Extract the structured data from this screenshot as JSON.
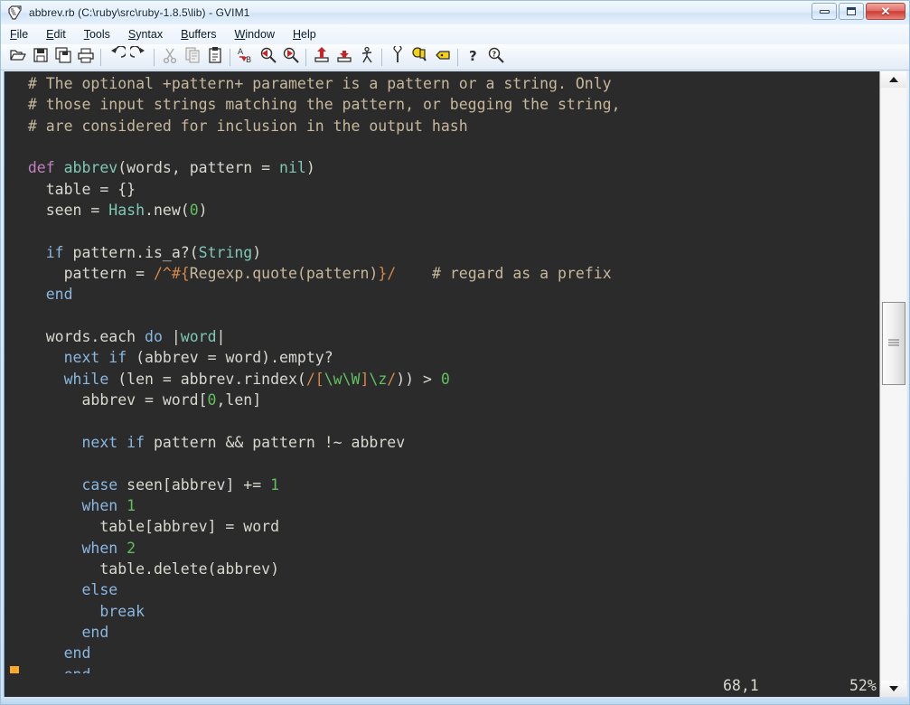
{
  "window": {
    "title": "abbrev.rb (C:\\ruby\\src\\ruby-1.8.5\\lib) - GVIM1",
    "app_icon": "vim-icon",
    "controls": {
      "minimize": "minimize-button",
      "maximize": "maximize-button",
      "close": "close-button",
      "close_glyph": "✕"
    }
  },
  "menubar": {
    "items": [
      {
        "label": "File",
        "accel": "F"
      },
      {
        "label": "Edit",
        "accel": "E"
      },
      {
        "label": "Tools",
        "accel": "T"
      },
      {
        "label": "Syntax",
        "accel": "S"
      },
      {
        "label": "Buffers",
        "accel": "B"
      },
      {
        "label": "Window",
        "accel": "W"
      },
      {
        "label": "Help",
        "accel": "H"
      }
    ]
  },
  "toolbar": {
    "buttons": [
      {
        "name": "open-file-icon",
        "enabled": true
      },
      {
        "name": "save-file-icon",
        "enabled": true
      },
      {
        "name": "save-all-icon",
        "enabled": true
      },
      {
        "name": "print-icon",
        "enabled": true
      },
      {
        "name": "separator"
      },
      {
        "name": "undo-icon",
        "enabled": true
      },
      {
        "name": "redo-icon",
        "enabled": true
      },
      {
        "name": "separator"
      },
      {
        "name": "cut-icon",
        "enabled": false
      },
      {
        "name": "copy-icon",
        "enabled": false
      },
      {
        "name": "paste-icon",
        "enabled": true
      },
      {
        "name": "separator"
      },
      {
        "name": "find-replace-icon",
        "enabled": true
      },
      {
        "name": "find-next-icon",
        "enabled": true
      },
      {
        "name": "find-previous-icon",
        "enabled": true
      },
      {
        "name": "separator"
      },
      {
        "name": "load-session-icon",
        "enabled": true
      },
      {
        "name": "save-session-icon",
        "enabled": true
      },
      {
        "name": "run-script-icon",
        "enabled": true
      },
      {
        "name": "separator"
      },
      {
        "name": "make-icon",
        "enabled": true
      },
      {
        "name": "build-tags-icon",
        "enabled": true
      },
      {
        "name": "jump-to-tag-icon",
        "enabled": true
      },
      {
        "name": "separator"
      },
      {
        "name": "help-icon",
        "enabled": true
      },
      {
        "name": "find-help-icon",
        "enabled": true
      }
    ]
  },
  "editor": {
    "filetype": "ruby",
    "background": "#2b2b2b",
    "cursor_color": "#ffa726",
    "lines": [
      [
        {
          "t": "  ",
          "c": "ident"
        },
        {
          "t": "# The optional +pattern+ parameter is a pattern or a string. Only",
          "c": "comment"
        }
      ],
      [
        {
          "t": "  ",
          "c": "ident"
        },
        {
          "t": "# those input strings matching the pattern, or begging the string,",
          "c": "comment"
        }
      ],
      [
        {
          "t": "  ",
          "c": "ident"
        },
        {
          "t": "# are considered for inclusion in the output hash",
          "c": "comment"
        }
      ],
      [],
      [
        {
          "t": "  ",
          "c": "ident"
        },
        {
          "t": "def",
          "c": "define"
        },
        {
          "t": " ",
          "c": "ident"
        },
        {
          "t": "abbrev",
          "c": "func"
        },
        {
          "t": "(words, pattern = ",
          "c": "ident"
        },
        {
          "t": "nil",
          "c": "const"
        },
        {
          "t": ")",
          "c": "ident"
        }
      ],
      [
        {
          "t": "    table = {}",
          "c": "ident"
        }
      ],
      [
        {
          "t": "    seen = ",
          "c": "ident"
        },
        {
          "t": "Hash",
          "c": "const"
        },
        {
          "t": ".new(",
          "c": "ident"
        },
        {
          "t": "0",
          "c": "number"
        },
        {
          "t": ")",
          "c": "ident"
        }
      ],
      [],
      [
        {
          "t": "    ",
          "c": "ident"
        },
        {
          "t": "if",
          "c": "keyword"
        },
        {
          "t": " pattern.is_a?(",
          "c": "ident"
        },
        {
          "t": "String",
          "c": "const"
        },
        {
          "t": ")",
          "c": "ident"
        }
      ],
      [
        {
          "t": "      pattern = ",
          "c": "ident"
        },
        {
          "t": "/^#{",
          "c": "regex"
        },
        {
          "t": "Regexp.quote(pattern)",
          "c": "interp"
        },
        {
          "t": "}/",
          "c": "regex"
        },
        {
          "t": "    ",
          "c": "ident"
        },
        {
          "t": "# regard as a prefix",
          "c": "comment"
        }
      ],
      [
        {
          "t": "    ",
          "c": "ident"
        },
        {
          "t": "end",
          "c": "keyword"
        }
      ],
      [],
      [
        {
          "t": "    words.each ",
          "c": "ident"
        },
        {
          "t": "do",
          "c": "keyword"
        },
        {
          "t": " |",
          "c": "ident"
        },
        {
          "t": "word",
          "c": "blockvar"
        },
        {
          "t": "|",
          "c": "ident"
        }
      ],
      [
        {
          "t": "      ",
          "c": "ident"
        },
        {
          "t": "next",
          "c": "keyword"
        },
        {
          "t": " ",
          "c": "ident"
        },
        {
          "t": "if",
          "c": "keyword"
        },
        {
          "t": " (abbrev = word).empty?",
          "c": "ident"
        }
      ],
      [
        {
          "t": "      ",
          "c": "ident"
        },
        {
          "t": "while",
          "c": "keyword"
        },
        {
          "t": " (len = abbrev.rindex(",
          "c": "ident"
        },
        {
          "t": "/[",
          "c": "regex"
        },
        {
          "t": "\\w\\W",
          "c": "regesc"
        },
        {
          "t": "]",
          "c": "regex"
        },
        {
          "t": "\\z",
          "c": "regesc"
        },
        {
          "t": "/",
          "c": "regex"
        },
        {
          "t": ")) > ",
          "c": "ident"
        },
        {
          "t": "0",
          "c": "number"
        }
      ],
      [
        {
          "t": "        abbrev = word[",
          "c": "ident"
        },
        {
          "t": "0",
          "c": "number"
        },
        {
          "t": ",len]",
          "c": "ident"
        }
      ],
      [],
      [
        {
          "t": "        ",
          "c": "ident"
        },
        {
          "t": "next",
          "c": "keyword"
        },
        {
          "t": " ",
          "c": "ident"
        },
        {
          "t": "if",
          "c": "keyword"
        },
        {
          "t": " pattern && pattern !~ abbrev",
          "c": "ident"
        }
      ],
      [],
      [
        {
          "t": "        ",
          "c": "ident"
        },
        {
          "t": "case",
          "c": "keyword"
        },
        {
          "t": " seen[abbrev] += ",
          "c": "ident"
        },
        {
          "t": "1",
          "c": "number"
        }
      ],
      [
        {
          "t": "        ",
          "c": "ident"
        },
        {
          "t": "when",
          "c": "keyword"
        },
        {
          "t": " ",
          "c": "ident"
        },
        {
          "t": "1",
          "c": "number"
        }
      ],
      [
        {
          "t": "          table[abbrev] = word",
          "c": "ident"
        }
      ],
      [
        {
          "t": "        ",
          "c": "ident"
        },
        {
          "t": "when",
          "c": "keyword"
        },
        {
          "t": " ",
          "c": "ident"
        },
        {
          "t": "2",
          "c": "number"
        }
      ],
      [
        {
          "t": "          table.delete(abbrev)",
          "c": "ident"
        }
      ],
      [
        {
          "t": "        ",
          "c": "ident"
        },
        {
          "t": "else",
          "c": "keyword"
        }
      ],
      [
        {
          "t": "          ",
          "c": "ident"
        },
        {
          "t": "break",
          "c": "keyword"
        }
      ],
      [
        {
          "t": "        ",
          "c": "ident"
        },
        {
          "t": "end",
          "c": "keyword"
        }
      ],
      [
        {
          "t": "      ",
          "c": "ident"
        },
        {
          "t": "end",
          "c": "keyword"
        }
      ],
      [
        {
          "t": "CURSOR",
          "c": "cursor"
        },
        {
          "t": "    ",
          "c": "ident"
        },
        {
          "t": "end",
          "c": "keyword"
        }
      ]
    ]
  },
  "statusline": {
    "position": "68,1",
    "percent": "52%"
  },
  "scrollbar": {
    "up_arrow": "scroll-up-arrow",
    "down_arrow": "scroll-down-arrow",
    "thumb": "scroll-thumb"
  }
}
